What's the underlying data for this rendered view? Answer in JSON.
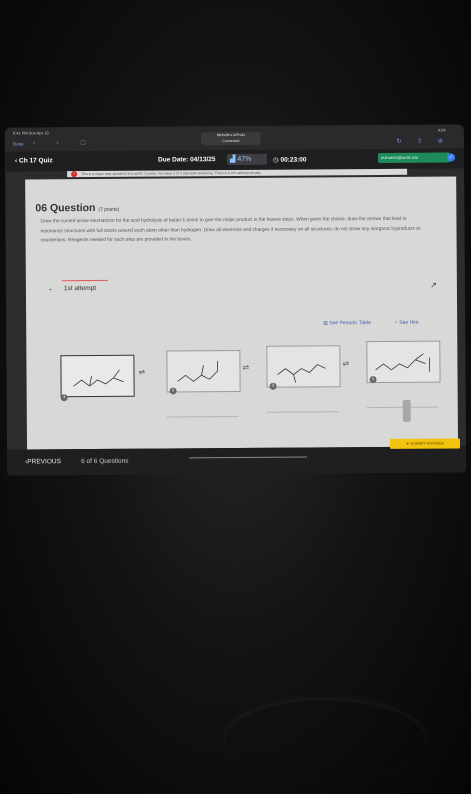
{
  "status_bar": {
    "time": "9:41 PM  Sun Apr 13",
    "done_label": "Done",
    "airplay_line1": "Michelle's AirPods",
    "airplay_line2": "Connected",
    "battery": "41%"
  },
  "top_bar": {
    "back_label": "Ch 17 Quiz",
    "due_date": "Due Date: 04/13/25",
    "score": "47%",
    "timer": "00:23:00",
    "email": "mzhuerta@ucsd.edu"
  },
  "banner": {
    "text": "This is a major step question! It is worth 7 points. You have 3 of 3 attempts remaining. There is a 0% attempt penalty"
  },
  "question": {
    "title": "06 Question",
    "points": "(7 points)",
    "instructions": "Draw the curved arrow mechanism for the acid hydrolysis of butan-1-imine to give the major product in the fewest steps. When given the choice, draw the arrows that lead to resonance structures with full octets around each atom other than hydrogen. Draw all electrons and charges if necessary on all structures; do not show any inorganic byproducts or counterions. Reagents needed for each step are provided in the boxes."
  },
  "attempt": {
    "label": "1st attempt"
  },
  "links": {
    "periodic_table": "See Periodic Table",
    "hint": "See Hint"
  },
  "footer": {
    "previous_label": "PREVIOUS",
    "question_count": "6 of 6 Questions",
    "submit_label": "SUBMIT ANSWER"
  },
  "colors": {
    "link": "#3f64b4",
    "submit_bg": "#f2c40f",
    "email_badge": "#1f8a5a",
    "warning": "#d62828"
  }
}
